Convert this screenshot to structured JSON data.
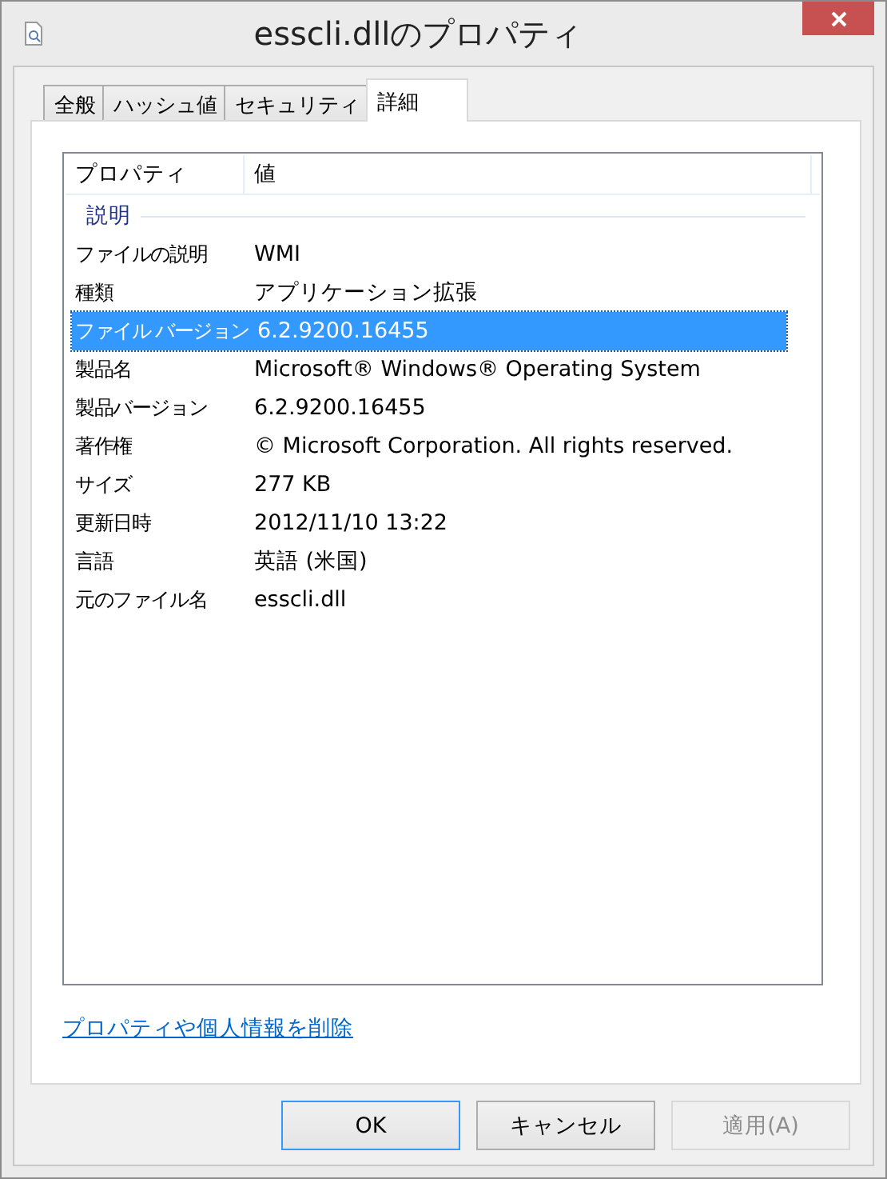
{
  "window": {
    "title": "esscli.dllのプロパティ"
  },
  "tabs": [
    {
      "label": "全般",
      "selected": false
    },
    {
      "label": "ハッシュ値",
      "selected": false
    },
    {
      "label": "セキュリティ",
      "selected": false
    },
    {
      "label": "詳細",
      "selected": true
    }
  ],
  "details": {
    "columns": [
      "プロパティ",
      "値"
    ],
    "group": "説明",
    "rows": [
      {
        "property": "ファイルの説明",
        "value": "WMI",
        "selected": false
      },
      {
        "property": "種類",
        "value": "アプリケーション拡張",
        "selected": false
      },
      {
        "property": "ファイル バージョン",
        "value": "6.2.9200.16455",
        "selected": true
      },
      {
        "property": "製品名",
        "value": "Microsoft® Windows® Operating System",
        "selected": false
      },
      {
        "property": "製品バージョン",
        "value": "6.2.9200.16455",
        "selected": false
      },
      {
        "property": "著作権",
        "value": "© Microsoft Corporation. All rights reserved.",
        "selected": false
      },
      {
        "property": "サイズ",
        "value": "277 KB",
        "selected": false
      },
      {
        "property": "更新日時",
        "value": "2012/11/10 13:22",
        "selected": false
      },
      {
        "property": "言語",
        "value": "英語 (米国)",
        "selected": false
      },
      {
        "property": "元のファイル名",
        "value": "esscli.dll",
        "selected": false
      }
    ]
  },
  "link": "プロパティや個人情報を削除",
  "buttons": [
    {
      "label": "OK",
      "default": true,
      "disabled": false
    },
    {
      "label": "キャンセル",
      "default": false,
      "disabled": false
    },
    {
      "label": "適用(A)",
      "default": false,
      "disabled": true
    }
  ]
}
